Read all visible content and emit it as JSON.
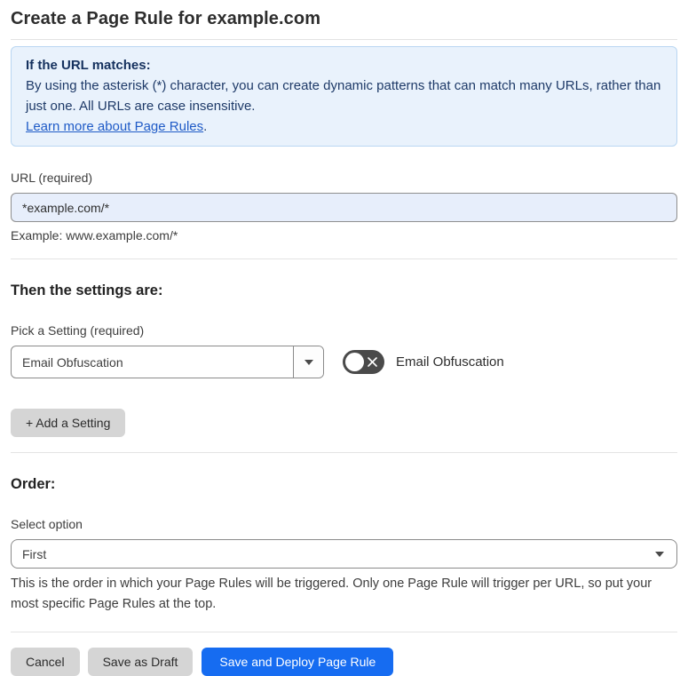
{
  "page": {
    "title": "Create a Page Rule for example.com"
  },
  "info_box": {
    "heading": "If the URL matches:",
    "body": "By using the asterisk (*) character, you can create dynamic patterns that can match many URLs, rather than just one. All URLs are case insensitive.",
    "link_label": "Learn more about Page Rules",
    "link_suffix": "."
  },
  "url_field": {
    "label": "URL (required)",
    "value": "*example.com/*",
    "helper": "Example: www.example.com/*"
  },
  "settings_section": {
    "heading": "Then the settings are:",
    "picker_label": "Pick a Setting (required)",
    "selected_setting": "Email Obfuscation",
    "toggle_label": "Email Obfuscation",
    "toggle_state": "off",
    "add_setting_label": "+ Add a Setting"
  },
  "order_section": {
    "heading": "Order:",
    "select_label": "Select option",
    "selected_option": "First",
    "helper": "This is the order in which your Page Rules will be triggered. Only one Page Rule will trigger per URL, so put your most specific Page Rules at the top."
  },
  "footer": {
    "cancel_label": "Cancel",
    "save_draft_label": "Save as Draft",
    "save_deploy_label": "Save and Deploy Page Rule"
  },
  "icons": {
    "dropdown_caret": "caret-down-icon",
    "toggle_off": "x-icon"
  },
  "colors": {
    "accent_blue": "#166cf1",
    "info_bg": "#e9f2fc",
    "info_border": "#b9d6f2",
    "info_text": "#1e3a68",
    "link_blue": "#1f5bc7",
    "input_autofill_bg": "#e7eefb",
    "button_gray": "#d5d5d5",
    "toggle_off_bg": "#4a4a4a"
  }
}
